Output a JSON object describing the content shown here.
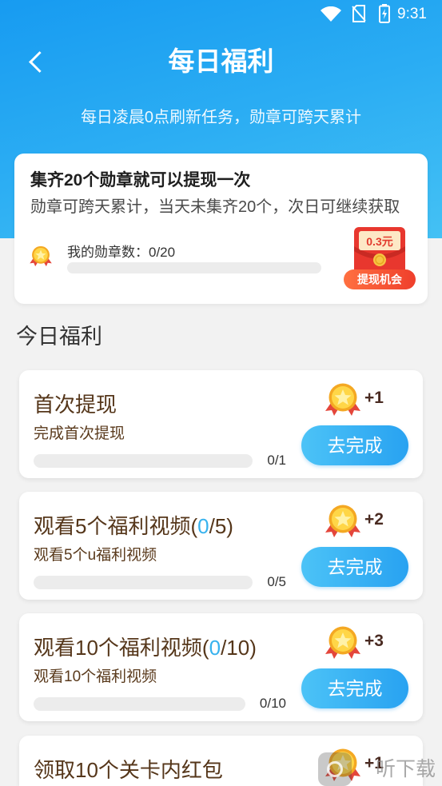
{
  "status_bar": {
    "time": "9:31"
  },
  "header": {
    "title": "每日福利",
    "subtitle": "每日凌晨0点刷新任务，勋章可跨天累计"
  },
  "summary_card": {
    "title": "集齐20个勋章就可以提现一次",
    "description": "勋章可跨天累计，当天未集齐20个，次日可继续获取",
    "medal_label": "我的勋章数：0/20",
    "medal_progress": 0,
    "reward_amount": "0.3元",
    "reward_label": "提现机会"
  },
  "section_title": "今日福利",
  "tasks": [
    {
      "title_before": "首次提现",
      "title_highlight": "",
      "title_after": "",
      "subtitle": "完成首次提现",
      "progress_text": "0/1",
      "progress": 0,
      "reward": "+1",
      "button": "去完成"
    },
    {
      "title_before": "观看5个福利视频(",
      "title_highlight": "0",
      "title_after": "/5)",
      "subtitle": "观看5个u福利视频",
      "progress_text": "0/5",
      "progress": 0,
      "reward": "+2",
      "button": "去完成"
    },
    {
      "title_before": "观看10个福利视频(",
      "title_highlight": "0",
      "title_after": "/10)",
      "subtitle": "观看10个福利视频",
      "progress_text": "0/10",
      "progress": 0,
      "reward": "+3",
      "button": "去完成"
    },
    {
      "title_before": "领取10个关卡内红包",
      "title_highlight": "",
      "title_after": "",
      "reward": "+1"
    }
  ],
  "icons": {
    "back": "chevron-left-icon",
    "medal": "medal-icon",
    "reward": "red-envelope-icon",
    "wifi": "wifi-icon",
    "sim": "no-sim-icon",
    "battery": "battery-charging-icon"
  },
  "colors": {
    "header_blue": "#2badf3",
    "button_blue": "#28a2f1",
    "highlight_blue": "#37b2ee",
    "task_title_brown": "#55361a",
    "background": "#f2f2f2"
  },
  "watermark": "听下载"
}
